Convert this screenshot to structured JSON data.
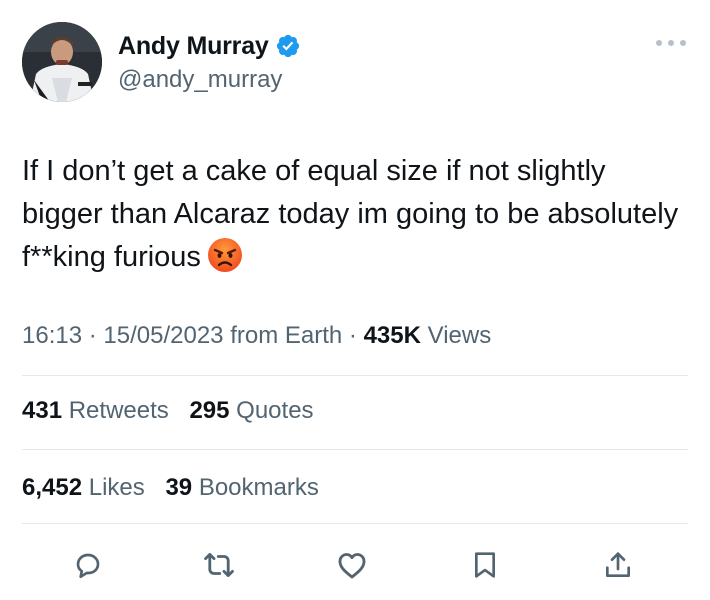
{
  "author": {
    "display_name": "Andy Murray",
    "handle": "@andy_murray",
    "verified": true
  },
  "tweet": {
    "text": "If I don’t get a cake of equal size if not slightly bigger than Alcaraz today im going to be absolutely f**king furious",
    "emoji": "angry-face"
  },
  "meta": {
    "time": "16:13",
    "separator": "·",
    "date": "15/05/2023",
    "source": "from Earth",
    "views_count": "435K",
    "views_label": "Views"
  },
  "stats": {
    "retweets_count": "431",
    "retweets_label": "Retweets",
    "quotes_count": "295",
    "quotes_label": "Quotes",
    "likes_count": "6,452",
    "likes_label": "Likes",
    "bookmarks_count": "39",
    "bookmarks_label": "Bookmarks"
  },
  "actions": [
    "reply-icon",
    "retweet-icon",
    "like-icon",
    "bookmark-icon",
    "share-icon"
  ],
  "colors": {
    "text": "#0f1419",
    "secondary": "#536471",
    "verified": "#1d9bf0",
    "divider": "#e6e9ec"
  }
}
